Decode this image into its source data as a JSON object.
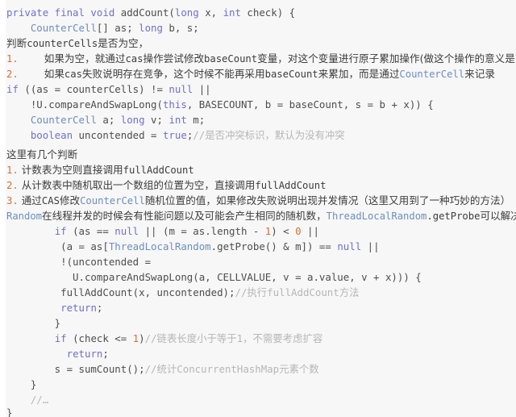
{
  "meta": {
    "kind": "code-snippet-screenshot",
    "language": "Java",
    "background_color": "#f7f7f7",
    "colors": {
      "keyword": "#6f6fd0",
      "type": "#6c8ebf",
      "number": "#d2713a",
      "comment": "#b6b6b6",
      "plain": "#4d4d4d",
      "list_marker": "#d2713a",
      "prose": "#3c3c3c"
    }
  },
  "lines": [
    {
      "id": "l1",
      "kind": "code",
      "indent": 0,
      "text": "private final void addCount(long x, int check) {",
      "tokens": [
        {
          "t": "private final void ",
          "c": "kw"
        },
        {
          "t": "addCount(",
          "c": "pln"
        },
        {
          "t": "long",
          "c": "kw"
        },
        {
          "t": " x, ",
          "c": "pln"
        },
        {
          "t": "int",
          "c": "kw"
        },
        {
          "t": " check) {",
          "c": "pln"
        }
      ]
    },
    {
      "id": "l2",
      "kind": "code",
      "indent": 4,
      "text": "CounterCell[] as; long b, s;",
      "tokens": [
        {
          "t": "    ",
          "c": "pln"
        },
        {
          "t": "CounterCell",
          "c": "typ"
        },
        {
          "t": "[] as; ",
          "c": "pln"
        },
        {
          "t": "long",
          "c": "kw"
        },
        {
          "t": " b, s;",
          "c": "pln"
        }
      ]
    },
    {
      "id": "l3",
      "kind": "prose",
      "text": "判断counterCells是否为空，",
      "tokens": [
        {
          "t": "判断",
          "c": "prose"
        },
        {
          "t": "counterCells",
          "c": "mono"
        },
        {
          "t": "是否为空，",
          "c": "prose"
        }
      ]
    },
    {
      "id": "l4",
      "kind": "list",
      "marker": "1.",
      "text": "如果为空，就通过cas操作尝试修改baseCount变量，对这个变量进行原子累加操作(做这个操作的意义是",
      "truncated": true,
      "tokens": [
        {
          "t": "如果为空，就通过",
          "c": "prose"
        },
        {
          "t": "cas",
          "c": "mono"
        },
        {
          "t": "操作尝试修改",
          "c": "prose"
        },
        {
          "t": "baseCount",
          "c": "mono"
        },
        {
          "t": "变量，对这个变量进行原子累加操作(做这个操作的意义是",
          "c": "prose"
        }
      ]
    },
    {
      "id": "l5",
      "kind": "list",
      "marker": "2.",
      "text": "如果cas失败说明存在竞争，这个时候不能再采用baseCount来累加，而是通过CounterCell来记录",
      "tokens": [
        {
          "t": "如果",
          "c": "prose"
        },
        {
          "t": "cas",
          "c": "mono"
        },
        {
          "t": "失败说明存在竞争，这个时候不能再采用",
          "c": "prose"
        },
        {
          "t": "baseCount",
          "c": "mono"
        },
        {
          "t": "来累加，而是通过",
          "c": "prose"
        },
        {
          "t": "CounterCell",
          "c": "ident-blue"
        },
        {
          "t": "来记录",
          "c": "prose"
        }
      ]
    },
    {
      "id": "l6",
      "kind": "code",
      "indent": 0,
      "text": "if ((as = counterCells) != null ||",
      "tokens": [
        {
          "t": "if",
          "c": "kw"
        },
        {
          "t": " ((as = counterCells) != ",
          "c": "pln"
        },
        {
          "t": "null",
          "c": "kw"
        },
        {
          "t": " ||",
          "c": "pln"
        }
      ]
    },
    {
      "id": "l7",
      "kind": "code",
      "indent": 4,
      "text": "!U.compareAndSwapLong(this, BASECOUNT, b = baseCount, s = b + x)) {",
      "tokens": [
        {
          "t": "    !U.compareAndSwapLong(",
          "c": "pln"
        },
        {
          "t": "this",
          "c": "kw"
        },
        {
          "t": ", BASECOUNT, b = baseCount, s = b + x)) {",
          "c": "pln"
        }
      ]
    },
    {
      "id": "l8",
      "kind": "code",
      "indent": 4,
      "text": "CounterCell a; long v; int m;",
      "tokens": [
        {
          "t": "    ",
          "c": "pln"
        },
        {
          "t": "CounterCell",
          "c": "typ"
        },
        {
          "t": " a; ",
          "c": "pln"
        },
        {
          "t": "long",
          "c": "kw"
        },
        {
          "t": " v; ",
          "c": "pln"
        },
        {
          "t": "int",
          "c": "kw"
        },
        {
          "t": " m;",
          "c": "pln"
        }
      ]
    },
    {
      "id": "l9",
      "kind": "code",
      "indent": 4,
      "text": "boolean uncontended = true;//是否冲突标识，默认为没有冲突",
      "tokens": [
        {
          "t": "    ",
          "c": "pln"
        },
        {
          "t": "boolean",
          "c": "kw"
        },
        {
          "t": " uncontended = ",
          "c": "pln"
        },
        {
          "t": "true",
          "c": "kw"
        },
        {
          "t": ";",
          "c": "pln"
        },
        {
          "t": "//是否冲突标识，默认为没有冲突",
          "c": "cmt"
        }
      ]
    },
    {
      "id": "l10",
      "kind": "prose",
      "text": "这里有几个判断",
      "tokens": [
        {
          "t": "这里有几个判断",
          "c": "prose"
        }
      ]
    },
    {
      "id": "l11",
      "kind": "list-tight",
      "marker": "1.",
      "text": "计数表为空则直接调用fullAddCount",
      "tokens": [
        {
          "t": "计数表为空则直接调用",
          "c": "prose"
        },
        {
          "t": "fullAddCount",
          "c": "mono"
        }
      ]
    },
    {
      "id": "l12",
      "kind": "list-tight",
      "marker": "2.",
      "text": "从计数表中随机取出一个数组的位置为空，直接调用fullAddCount",
      "tokens": [
        {
          "t": "从计数表中随机取出一个数组的位置为空，直接调用",
          "c": "prose"
        },
        {
          "t": "fullAddCount",
          "c": "mono"
        }
      ]
    },
    {
      "id": "l13",
      "kind": "list-tight",
      "marker": "3.",
      "text": "通过CAS修改CounterCell随机位置的值，如果修改失败说明出现并发情况（这里又用到了一种巧妙的方法）",
      "truncated": true,
      "tokens": [
        {
          "t": "通过",
          "c": "prose"
        },
        {
          "t": "CAS",
          "c": "mono"
        },
        {
          "t": "修改",
          "c": "prose"
        },
        {
          "t": "CounterCell",
          "c": "ident-blue"
        },
        {
          "t": "随机位置的值，如果修改失败说明出现并发情况（这里又用到了一种巧妙的方法）",
          "c": "prose"
        }
      ]
    },
    {
      "id": "l14",
      "kind": "prose",
      "text": "Random在线程并发的时候会有性能问题以及可能会产生相同的随机数，ThreadLocalRandom.getProbe可以解决",
      "truncated": true,
      "tokens": [
        {
          "t": "Random",
          "c": "ident-blue"
        },
        {
          "t": "在线程并发的时候会有性能问题以及可能会产生相同的随机数，",
          "c": "prose"
        },
        {
          "t": "ThreadLocalRandom",
          "c": "ident-blue"
        },
        {
          "t": ".getProbe",
          "c": "mono"
        },
        {
          "t": "可以解决",
          "c": "prose"
        }
      ]
    },
    {
      "id": "l15",
      "kind": "code",
      "indent": 8,
      "text": "if (as == null || (m = as.length - 1) < 0 ||",
      "tokens": [
        {
          "t": "        ",
          "c": "pln"
        },
        {
          "t": "if",
          "c": "kw"
        },
        {
          "t": " (as == ",
          "c": "pln"
        },
        {
          "t": "null",
          "c": "kw"
        },
        {
          "t": " || (m = as.length - ",
          "c": "pln"
        },
        {
          "t": "1",
          "c": "num"
        },
        {
          "t": ") < ",
          "c": "pln"
        },
        {
          "t": "0",
          "c": "num"
        },
        {
          "t": " ||",
          "c": "pln"
        }
      ]
    },
    {
      "id": "l16",
      "kind": "code",
      "indent": 9,
      "text": "(a = as[ThreadLocalRandom.getProbe() & m]) == null ||",
      "tokens": [
        {
          "t": "         (a = as[",
          "c": "pln"
        },
        {
          "t": "ThreadLocalRandom",
          "c": "typ"
        },
        {
          "t": ".getProbe() & m]) == ",
          "c": "pln"
        },
        {
          "t": "null",
          "c": "kw"
        },
        {
          "t": " ||",
          "c": "pln"
        }
      ]
    },
    {
      "id": "l17",
      "kind": "code",
      "indent": 9,
      "text": "!(uncontended =",
      "tokens": [
        {
          "t": "         !(uncontended =",
          "c": "pln"
        }
      ]
    },
    {
      "id": "l18",
      "kind": "code",
      "indent": 11,
      "text": "U.compareAndSwapLong(a, CELLVALUE, v = a.value, v + x))) {",
      "tokens": [
        {
          "t": "           U.compareAndSwapLong(a, CELLVALUE, v = a.value, v + x))) {",
          "c": "pln"
        }
      ]
    },
    {
      "id": "l19",
      "kind": "code",
      "indent": 9,
      "text": "fullAddCount(x, uncontended);//执行fullAddCount方法",
      "tokens": [
        {
          "t": "         fullAddCount(x, uncontended);",
          "c": "pln"
        },
        {
          "t": "//执行fullAddCount方法",
          "c": "cmt"
        }
      ]
    },
    {
      "id": "l20",
      "kind": "code",
      "indent": 9,
      "text": "return;",
      "tokens": [
        {
          "t": "         ",
          "c": "pln"
        },
        {
          "t": "return",
          "c": "kw"
        },
        {
          "t": ";",
          "c": "pln"
        }
      ]
    },
    {
      "id": "l21",
      "kind": "code",
      "indent": 8,
      "text": "}",
      "tokens": [
        {
          "t": "        }",
          "c": "pln"
        }
      ]
    },
    {
      "id": "l22",
      "kind": "code",
      "indent": 8,
      "text": "if (check <= 1)//链表长度小于等于1，不需要考虑扩容",
      "tokens": [
        {
          "t": "        ",
          "c": "pln"
        },
        {
          "t": "if",
          "c": "kw"
        },
        {
          "t": " (check <= ",
          "c": "pln"
        },
        {
          "t": "1",
          "c": "num"
        },
        {
          "t": ")",
          "c": "pln"
        },
        {
          "t": "//链表长度小于等于1，不需要考虑扩容",
          "c": "cmt"
        }
      ]
    },
    {
      "id": "l23",
      "kind": "code",
      "indent": 10,
      "text": "return;",
      "tokens": [
        {
          "t": "          ",
          "c": "pln"
        },
        {
          "t": "return",
          "c": "kw"
        },
        {
          "t": ";",
          "c": "pln"
        }
      ]
    },
    {
      "id": "l24",
      "kind": "code",
      "indent": 8,
      "text": "s = sumCount();//统计ConcurrentHashMap元素个数",
      "tokens": [
        {
          "t": "        s = sumCount();",
          "c": "pln"
        },
        {
          "t": "//统计ConcurrentHashMap元素个数",
          "c": "cmt"
        }
      ]
    },
    {
      "id": "l25",
      "kind": "code",
      "indent": 4,
      "text": "}",
      "tokens": [
        {
          "t": "    }",
          "c": "pln"
        }
      ]
    },
    {
      "id": "l26",
      "kind": "code",
      "indent": 4,
      "text": "//…",
      "tokens": [
        {
          "t": "    ",
          "c": "pln"
        },
        {
          "t": "//…",
          "c": "cmt"
        }
      ]
    },
    {
      "id": "l27",
      "kind": "code",
      "indent": 0,
      "text": "}",
      "tokens": [
        {
          "t": "}",
          "c": "pln"
        }
      ]
    }
  ],
  "line_layout": {
    "top_offsets": [
      6,
      25,
      44,
      63,
      82,
      101,
      120,
      139,
      158,
      182,
      201,
      220,
      239,
      258,
      277,
      296,
      315,
      334,
      353,
      372,
      391,
      410,
      429,
      448,
      467,
      486,
      502
    ]
  }
}
